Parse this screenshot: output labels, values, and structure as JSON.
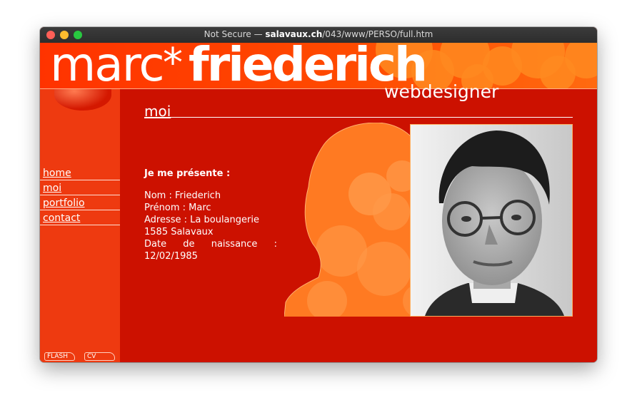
{
  "browser": {
    "title_prefix": "Not Secure — ",
    "domain": "salavaux.ch",
    "path": "/043/www/PERSO/full.htm"
  },
  "header": {
    "logo_first": "marc",
    "logo_star": "*",
    "logo_last": "friederich",
    "tagline": "webdesigner"
  },
  "sidebar": {
    "items": [
      {
        "label": "home"
      },
      {
        "label": "moi"
      },
      {
        "label": "portfolio"
      },
      {
        "label": "contact"
      }
    ],
    "bottom_buttons": [
      {
        "label": "FLASH"
      },
      {
        "label": "CV"
      }
    ]
  },
  "main": {
    "section_title": "moi",
    "intro_heading": "Je me présente :",
    "info": [
      "Nom : Friederich",
      "Prénom : Marc",
      "Adresse : La boulangerie",
      "1585 Salavaux"
    ],
    "birth_words": [
      "Date",
      "de",
      "naissance",
      ":"
    ],
    "birth_date": "12/02/1985"
  },
  "colors": {
    "page_red": "#cc1100",
    "sidebar_red": "#ee3a10",
    "header_orange": "#ff4a00",
    "silhouette_orange": "#ff7a20"
  }
}
